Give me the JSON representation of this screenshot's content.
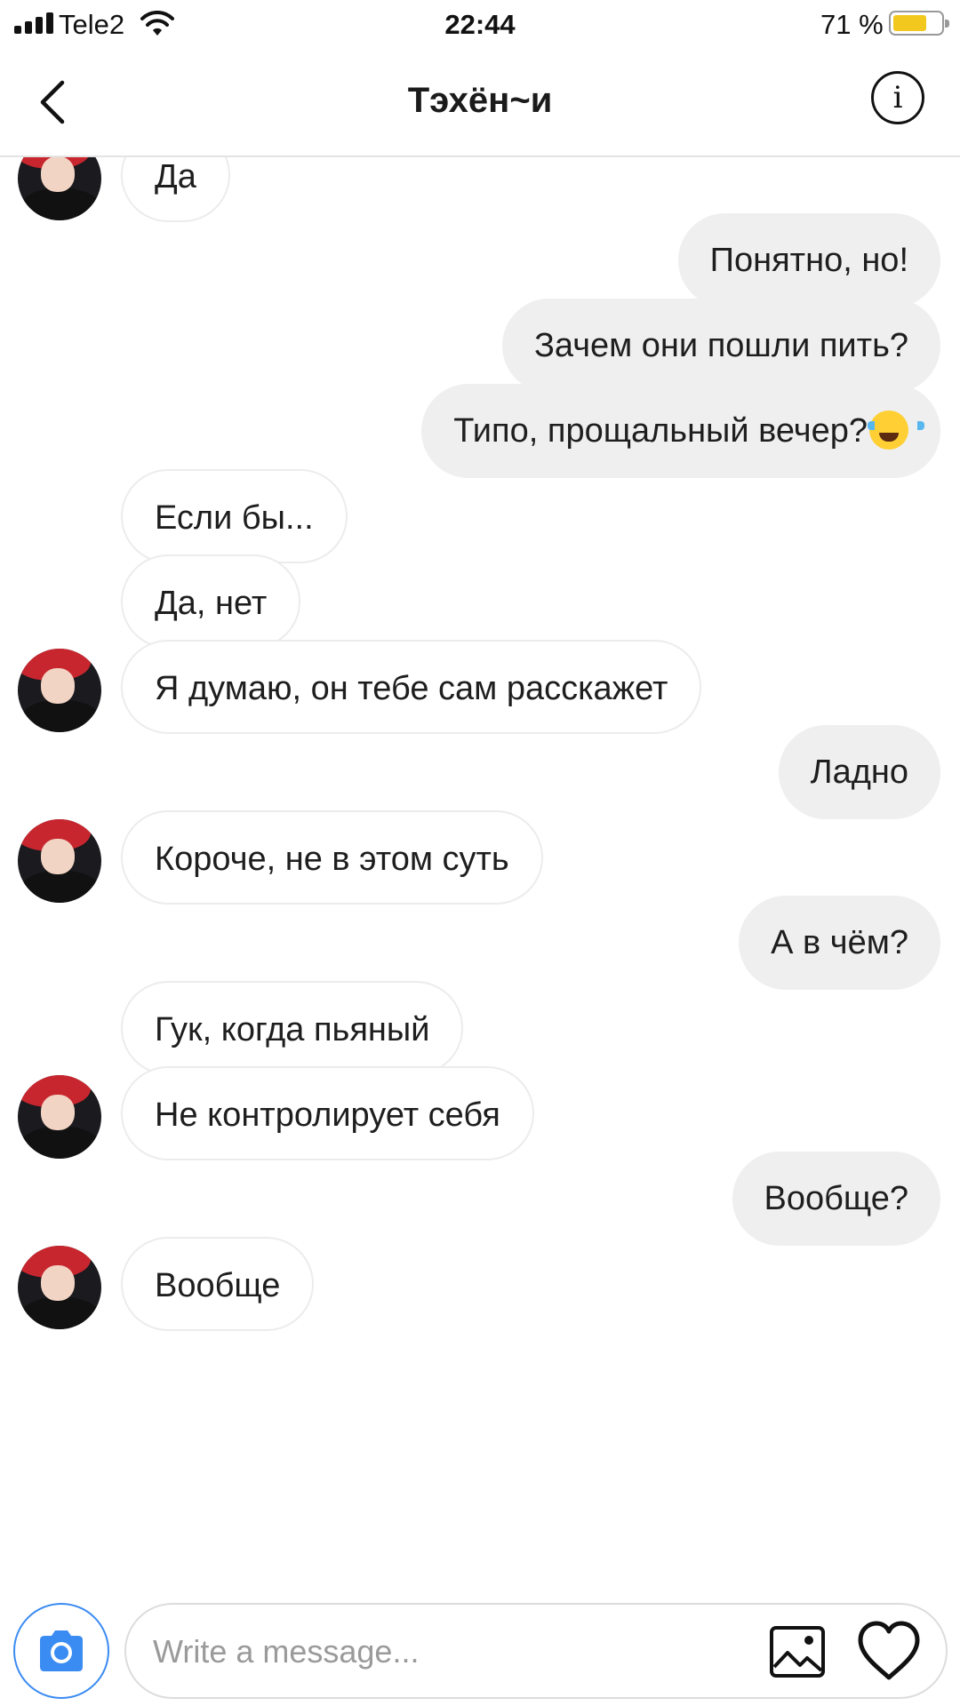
{
  "status_bar": {
    "carrier": "Tele2",
    "time": "22:44",
    "battery_text": "71 %",
    "battery_level": 0.71,
    "icons": [
      "signal-icon",
      "wifi-icon",
      "battery-icon"
    ]
  },
  "header": {
    "title": "Тэхён~и",
    "back_icon": "chevron-left-icon",
    "info_icon": "info-icon"
  },
  "messages": [
    {
      "side": "in",
      "avatar": true,
      "text": "Да"
    },
    {
      "side": "out",
      "text": "Понятно, но!"
    },
    {
      "side": "out",
      "text": "Зачем они пошли пить?"
    },
    {
      "side": "out",
      "text": "Типо, прощальный вечер?",
      "emoji": "laughing-tears-emoji"
    },
    {
      "side": "in",
      "avatar": false,
      "text": "Если бы..."
    },
    {
      "side": "in",
      "avatar": false,
      "text": "Да, нет"
    },
    {
      "side": "in",
      "avatar": true,
      "text": "Я думаю, он тебе сам расскажет"
    },
    {
      "side": "out",
      "text": "Ладно"
    },
    {
      "side": "in",
      "avatar": true,
      "text": "Короче, не в этом суть"
    },
    {
      "side": "out",
      "text": "А в чём?"
    },
    {
      "side": "in",
      "avatar": false,
      "text": "Гук, когда пьяный"
    },
    {
      "side": "in",
      "avatar": true,
      "text": "Не контролирует себя"
    },
    {
      "side": "out",
      "text": "Вообще?"
    },
    {
      "side": "in",
      "avatar": true,
      "text": "Вообще"
    }
  ],
  "composer": {
    "placeholder": "Write a message...",
    "value": "",
    "camera_icon": "camera-icon",
    "image_icon": "image-icon",
    "heart_icon": "heart-icon"
  },
  "colors": {
    "outgoing_bubble": "#efefef",
    "incoming_border": "#ececec",
    "camera_accent": "#3a8bf2",
    "battery_fill": "#f2c81e",
    "avatar_hair": "#c8262e"
  }
}
